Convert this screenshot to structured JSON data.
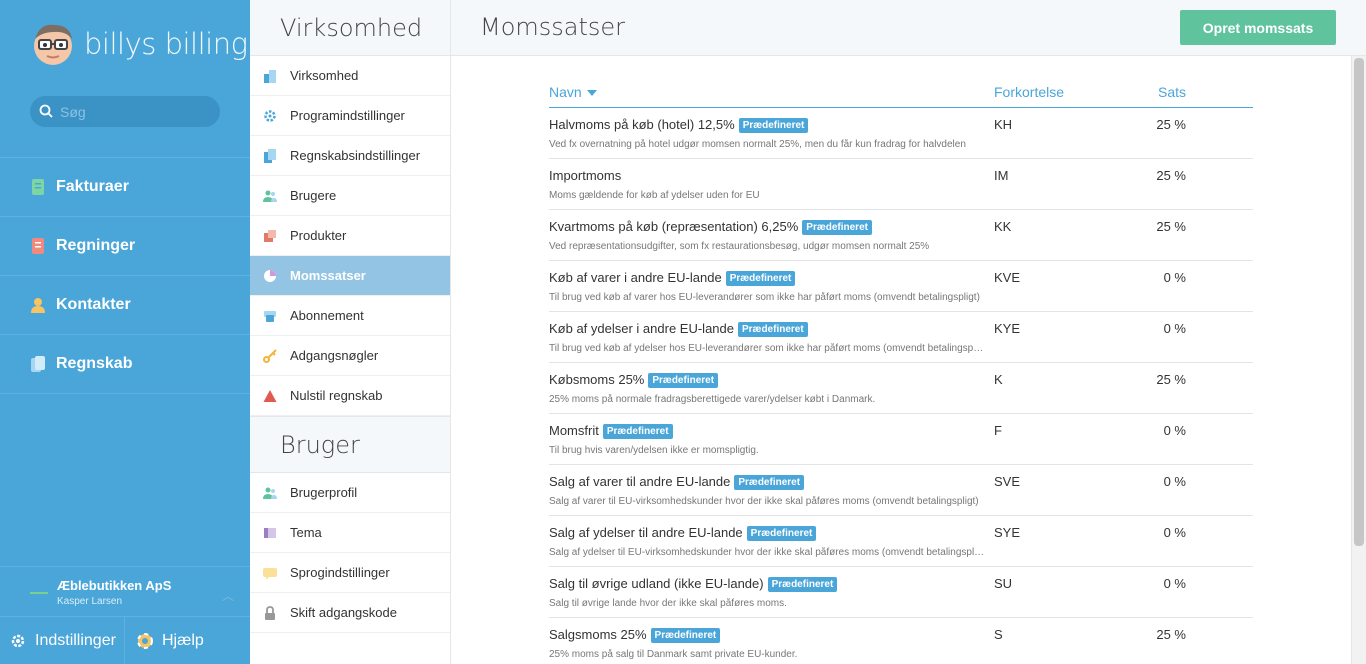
{
  "app": {
    "logo_text": "billys billing"
  },
  "search": {
    "placeholder": "Søg"
  },
  "nav": [
    {
      "label": "Fakturaer",
      "icon": "invoice-icon",
      "color": "#7cd6a4"
    },
    {
      "label": "Regninger",
      "icon": "bill-icon",
      "color": "#f08a7e"
    },
    {
      "label": "Kontakter",
      "icon": "contact-icon",
      "color": "#f5c465"
    },
    {
      "label": "Regnskab",
      "icon": "accounting-icon",
      "color": "#a5d6f2"
    }
  ],
  "company": {
    "name": "Æblebutikken ApS",
    "user": "Kasper Larsen"
  },
  "bottom": {
    "settings": "Indstillinger",
    "help": "Hjælp"
  },
  "submenu": {
    "heading1": "Virksomhed",
    "items1": [
      {
        "label": "Virksomhed",
        "icon": "building-icon"
      },
      {
        "label": "Programindstillinger",
        "icon": "gear-icon"
      },
      {
        "label": "Regnskabsindstillinger",
        "icon": "ledger-icon"
      },
      {
        "label": "Brugere",
        "icon": "users-icon"
      },
      {
        "label": "Produkter",
        "icon": "products-icon"
      },
      {
        "label": "Momssatser",
        "icon": "pie-icon"
      },
      {
        "label": "Abonnement",
        "icon": "subscription-icon"
      },
      {
        "label": "Adgangsnøgler",
        "icon": "key-icon"
      },
      {
        "label": "Nulstil regnskab",
        "icon": "warning-icon"
      }
    ],
    "heading2": "Bruger",
    "items2": [
      {
        "label": "Brugerprofil",
        "icon": "user-profile-icon"
      },
      {
        "label": "Tema",
        "icon": "theme-icon"
      },
      {
        "label": "Sprogindstillinger",
        "icon": "language-icon"
      },
      {
        "label": "Skift adgangskode",
        "icon": "lock-icon"
      }
    ]
  },
  "main": {
    "title": "Momssatser",
    "create_button": "Opret momssats",
    "columns": {
      "name": "Navn",
      "abbr": "Forkortelse",
      "rate": "Sats"
    },
    "badge_label": "Prædefineret",
    "rows": [
      {
        "name": "Halvmoms på køb (hotel) 12,5%",
        "predefined": true,
        "desc": "Ved fx overnatning på hotel udgør momsen normalt 25%, men du får kun fradrag for halvdelen",
        "abbr": "KH",
        "rate": "25 %"
      },
      {
        "name": "Importmoms",
        "predefined": false,
        "desc": "Moms gældende for køb af ydelser uden for EU",
        "abbr": "IM",
        "rate": "25 %"
      },
      {
        "name": "Kvartmoms på køb (repræsentation) 6,25%",
        "predefined": true,
        "desc": "Ved repræsentationsudgifter, som fx restaurationsbesøg, udgør momsen normalt 25%",
        "abbr": "KK",
        "rate": "25 %"
      },
      {
        "name": "Køb af varer i andre EU-lande",
        "predefined": true,
        "desc": "Til brug ved køb af varer hos EU-leverandører som ikke har påført moms (omvendt betalingspligt)",
        "abbr": "KVE",
        "rate": "0 %"
      },
      {
        "name": "Køb af ydelser i andre EU-lande",
        "predefined": true,
        "desc": "Til brug ved køb af ydelser hos EU-leverandører som ikke har påført moms (omvendt betalingspligt)",
        "abbr": "KYE",
        "rate": "0 %"
      },
      {
        "name": "Købsmoms 25%",
        "predefined": true,
        "desc": "25% moms på normale fradragsberettigede varer/ydelser købt i Danmark.",
        "abbr": "K",
        "rate": "25 %"
      },
      {
        "name": "Momsfrit",
        "predefined": true,
        "desc": "Til brug hvis varen/ydelsen ikke er momspligtig.",
        "abbr": "F",
        "rate": "0 %"
      },
      {
        "name": "Salg af varer til andre EU-lande",
        "predefined": true,
        "desc": "Salg af varer til EU-virksomhedskunder hvor der ikke skal påføres moms (omvendt betalingspligt)",
        "abbr": "SVE",
        "rate": "0 %"
      },
      {
        "name": "Salg af ydelser til andre EU-lande",
        "predefined": true,
        "desc": "Salg af ydelser til EU-virksomhedskunder hvor der ikke skal påføres moms (omvendt betalingspligt)",
        "abbr": "SYE",
        "rate": "0 %"
      },
      {
        "name": "Salg til øvrige udland (ikke EU-lande)",
        "predefined": true,
        "desc": "Salg til øvrige lande hvor der ikke skal påføres moms.",
        "abbr": "SU",
        "rate": "0 %"
      },
      {
        "name": "Salgsmoms 25%",
        "predefined": true,
        "desc": "25% moms på salg til Danmark samt private EU-kunder.",
        "abbr": "S",
        "rate": "25 %"
      }
    ]
  }
}
